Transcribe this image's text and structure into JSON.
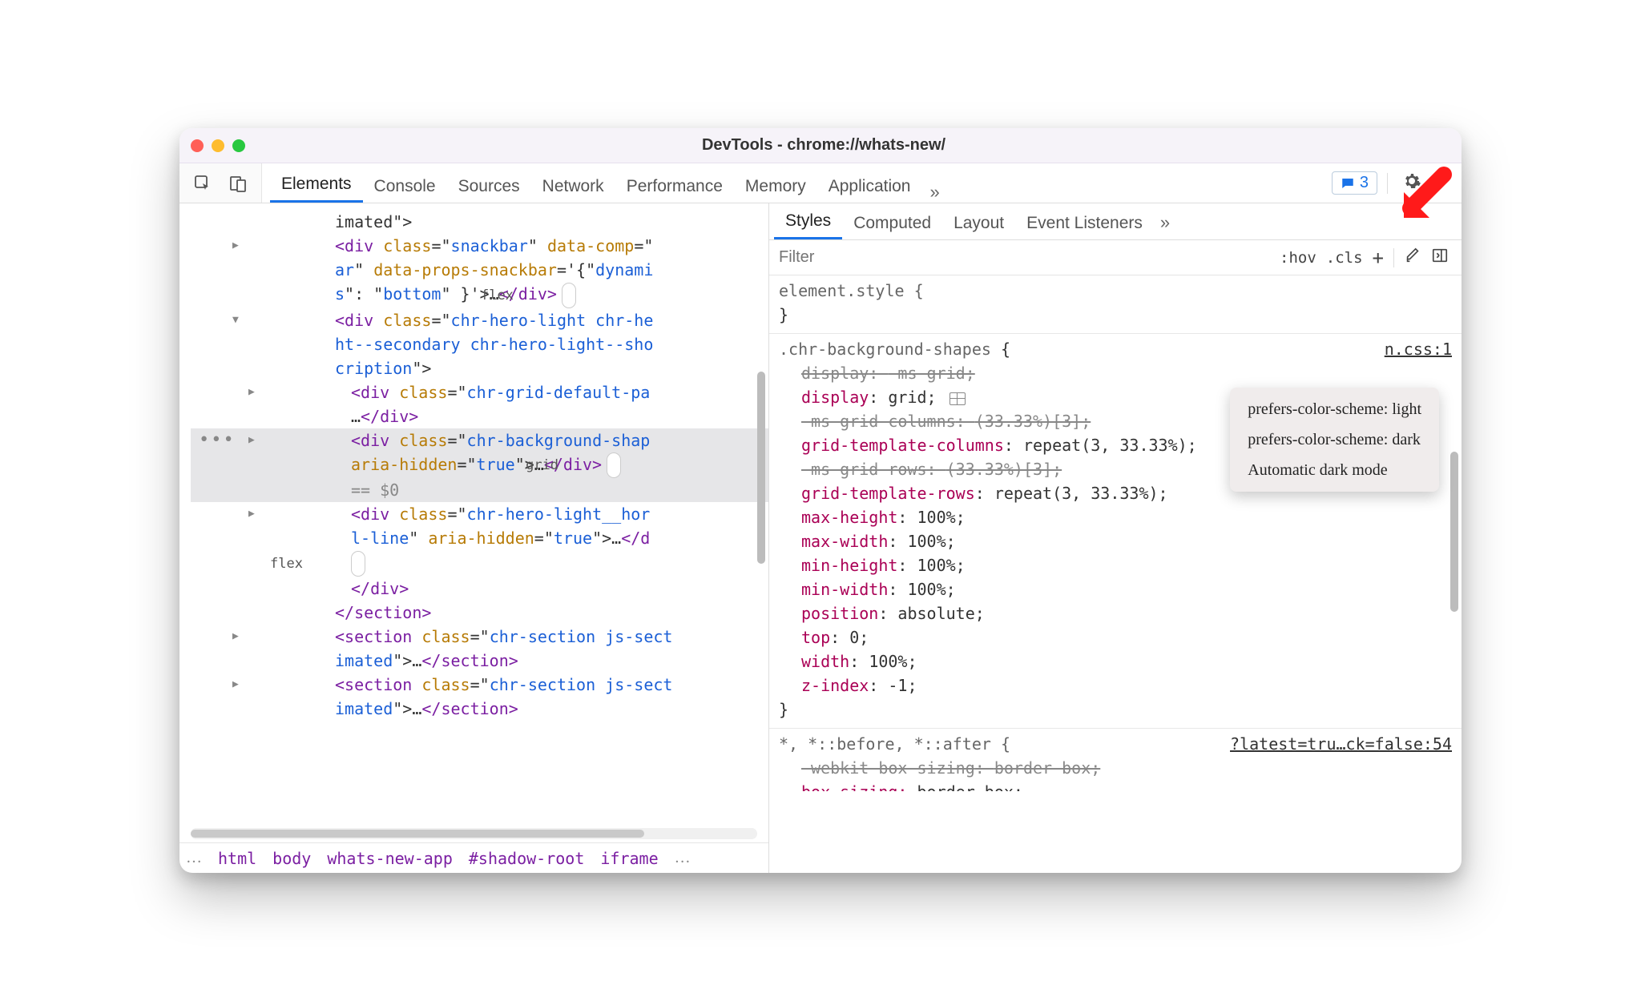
{
  "window": {
    "title": "DevTools - chrome://whats-new/"
  },
  "tabs": [
    "Elements",
    "Console",
    "Sources",
    "Network",
    "Performance",
    "Memory",
    "Application"
  ],
  "activeTab": "Elements",
  "messageCount": "3",
  "subtabs": [
    "Styles",
    "Computed",
    "Layout",
    "Event Listeners"
  ],
  "activeSubtab": "Styles",
  "filter": {
    "placeholder": "Filter",
    "hov": ":hov",
    "cls": ".cls",
    "plus": "+"
  },
  "dom": {
    "l0": "imated\">",
    "l1a": "<div class=\"snackbar\" data-comp=\"",
    "l1b": "ar\" data-props-snackbar='{\"dynami",
    "l1c": "s\": \"bottom\" }'>…</div>",
    "l1_pill": "flex",
    "l2a": "<div class=\"chr-hero-light chr-he",
    "l2b": "ht--secondary chr-hero-light--sho",
    "l2c": "cription\">",
    "l3a": "<div class=\"chr-grid-default-pa",
    "l3b": "…</div>",
    "l4a": "<div class=\"chr-background-shap",
    "l4b": "aria-hidden=\"true\">…</div>",
    "l4_pill": "grid",
    "l4_eq": "== $0",
    "l5a": "<div class=\"chr-hero-light__hor",
    "l5b": "l-line\" aria-hidden=\"true\">…</d",
    "l5_pill": "flex",
    "l6": "</div>",
    "l7": "</section>",
    "l8a": "<section class=\"chr-section js-sect",
    "l8b": "imated\">…</section>",
    "l9a": "<section class=\"chr-section js-sect",
    "l9b": "imated\">…</section>"
  },
  "breadcrumbs": [
    "html",
    "body",
    "whats-new-app",
    "#shadow-root",
    "iframe"
  ],
  "styles": {
    "elementStyle": "element.style {",
    "rule1": {
      "selector": ".chr-background-shapes",
      "source": "n.css:1",
      "props": [
        {
          "n": "display",
          "v": "-ms-grid",
          "struck": true
        },
        {
          "n": "display",
          "v": "grid",
          "icon": true
        },
        {
          "n": "-ms-grid-columns",
          "v": "(33.33%)[3]",
          "struck": true
        },
        {
          "n": "grid-template-columns",
          "v": "repeat(3, 33.33%)"
        },
        {
          "n": "-ms-grid-rows",
          "v": "(33.33%)[3]",
          "struck": true
        },
        {
          "n": "grid-template-rows",
          "v": "repeat(3, 33.33%)"
        },
        {
          "n": "max-height",
          "v": "100%"
        },
        {
          "n": "max-width",
          "v": "100%"
        },
        {
          "n": "min-height",
          "v": "100%"
        },
        {
          "n": "min-width",
          "v": "100%"
        },
        {
          "n": "position",
          "v": "absolute"
        },
        {
          "n": "top",
          "v": "0"
        },
        {
          "n": "width",
          "v": "100%"
        },
        {
          "n": "z-index",
          "v": "-1"
        }
      ]
    },
    "rule2": {
      "selector": "*, *::before, *::after {",
      "source": "?latest=tru…ck=false:54",
      "props": [
        {
          "n": "-webkit-box-sizing",
          "v": "border-box",
          "struck": true
        },
        {
          "n": "box-sizing",
          "v": "border-box"
        }
      ]
    }
  },
  "popup": {
    "items": [
      "prefers-color-scheme: light",
      "prefers-color-scheme: dark",
      "Automatic dark mode"
    ]
  }
}
